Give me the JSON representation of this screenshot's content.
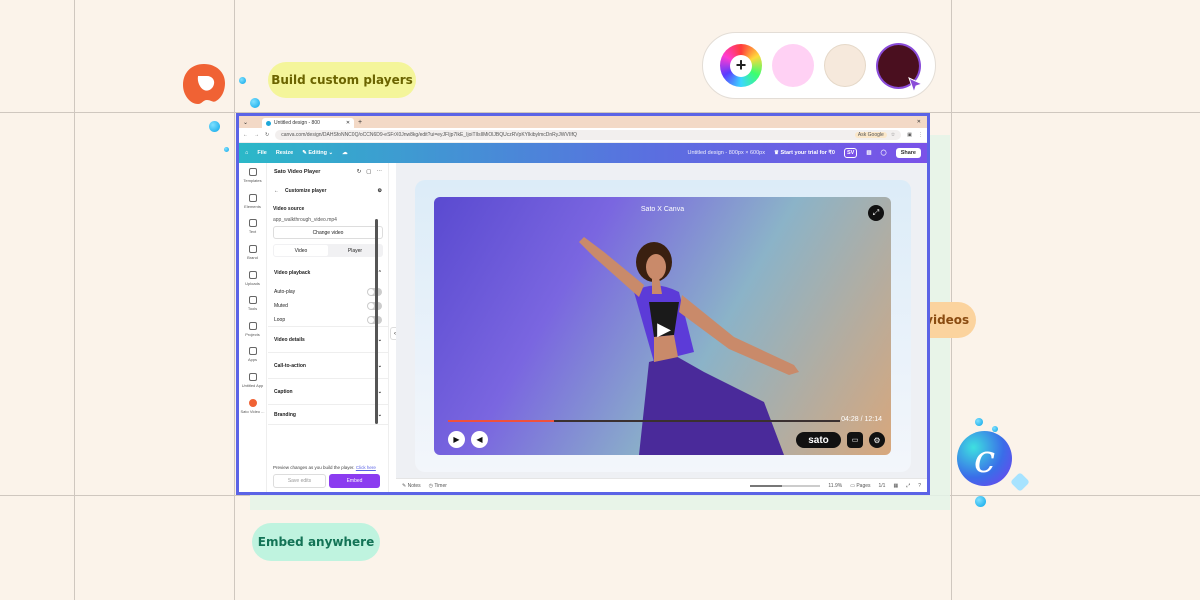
{
  "callouts": {
    "build": "Build custom players",
    "host": "Host videos",
    "embed": "Embed anywhere"
  },
  "palette": {
    "add_icon": "+",
    "swatches": [
      "#ffd1f4",
      "#f6e9dc",
      "#4a0f1f"
    ]
  },
  "browser": {
    "tab_title": "Untitled design - 800",
    "url": "canva.com/design/DAHSfoNNC0Q/oCCN6D9-eSFrX0Jnw8kg/edit?ui=eyJFIjp7IkE_IjoiTlIsIlMiOlJBQUczRVpKYlkibylmcDnRyJWVIIfQ",
    "ask_google": "Ask Google"
  },
  "canva_header": {
    "file": "File",
    "resize": "Resize",
    "editing": "Editing",
    "design_title": "Untitled design - 800px × 600px",
    "trial": "Start your trial for ₹0",
    "avatar": "SV",
    "share": "Share"
  },
  "rail": [
    {
      "label": "Templates",
      "icon": "templates-icon"
    },
    {
      "label": "Elements",
      "icon": "elements-icon"
    },
    {
      "label": "Text",
      "icon": "text-icon"
    },
    {
      "label": "Brand",
      "icon": "brand-icon"
    },
    {
      "label": "Uploads",
      "icon": "uploads-icon"
    },
    {
      "label": "Tools",
      "icon": "tools-icon"
    },
    {
      "label": "Projects",
      "icon": "projects-icon"
    },
    {
      "label": "Apps",
      "icon": "apps-icon"
    },
    {
      "label": "Untitled App",
      "icon": "app-icon"
    },
    {
      "label": "Sato Video ...",
      "icon": "sato-icon"
    }
  ],
  "panel": {
    "title": "Sato Video Player",
    "subtitle": "Customize player",
    "source_label": "Video source",
    "file_name": "app_walkthrough_video.mp4",
    "change_video": "Change video",
    "tab_video": "Video",
    "tab_player": "Player",
    "playback_title": "Video playback",
    "toggles": [
      "Auto-play",
      "Muted",
      "Loop"
    ],
    "sections": [
      "Video details",
      "Call-to-action",
      "Caption",
      "Branding"
    ],
    "preview_note": "Preview changes as you build the player.",
    "click_here": "Click here",
    "save_edits": "Save edits",
    "embed": "Embed"
  },
  "video": {
    "title": "Sato X Canva",
    "time": "04:28 / 12:14",
    "progress": 0.27,
    "brand": "sato"
  },
  "bottombar": {
    "notes": "Notes",
    "timer": "Timer",
    "zoom": "11.9%",
    "pages": "Pages",
    "page_count": "1/1",
    "zoom_level": 0.45
  }
}
